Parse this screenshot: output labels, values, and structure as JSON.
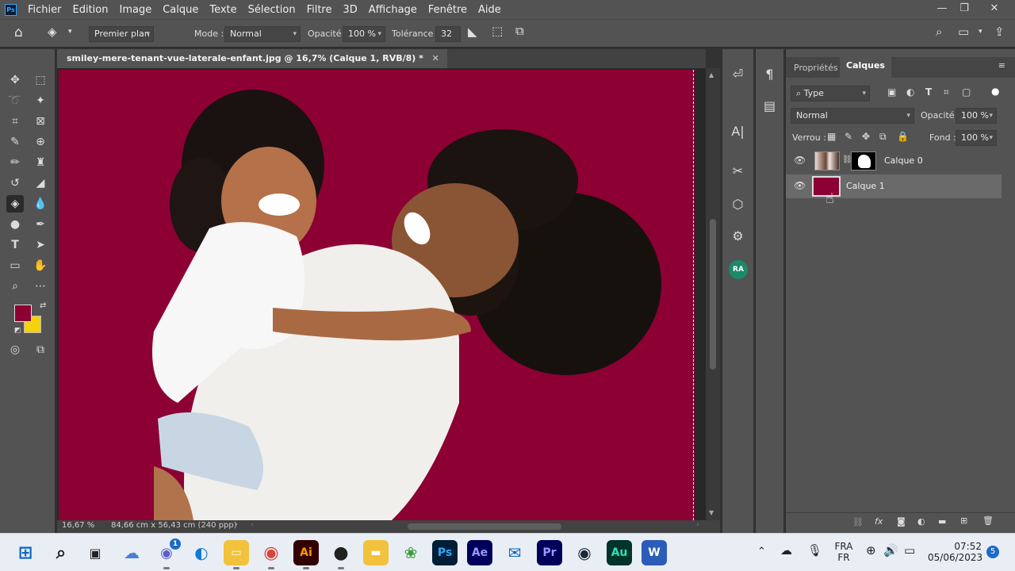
{
  "app": {
    "logo": "Ps"
  },
  "menu": [
    "Fichier",
    "Edition",
    "Image",
    "Calque",
    "Texte",
    "Sélection",
    "Filtre",
    "3D",
    "Affichage",
    "Fenêtre",
    "Aide"
  ],
  "window_controls": {
    "minimize": "—",
    "restore": "❐",
    "close": "✕"
  },
  "options": {
    "fill_source": "Premier plan",
    "mode_label": "Mode :",
    "mode_value": "Normal",
    "opacity_label": "Opacité :",
    "opacity_value": "100 %",
    "tolerance_label": "Tolérance :",
    "tolerance_value": "32"
  },
  "document": {
    "tab_title": "smiley-mere-tenant-vue-laterale-enfant.jpg @ 16,7% (Calque 1, RVB/8) *",
    "tab_close": "✕",
    "zoom": "16,67 %",
    "doc_size": "84,66 cm x 56,43 cm (240 ppp)",
    "canvas_color": "#8c0034"
  },
  "colors": {
    "foreground": "#8c0034",
    "background": "#f5d20a"
  },
  "panel": {
    "tab_properties": "Propriétés",
    "tab_layers": "Calques",
    "filter_type": "Type",
    "blend_mode": "Normal",
    "opacity_label": "Opacité :",
    "opacity_value": "100 %",
    "lock_label": "Verrou :",
    "fill_label": "Fond :",
    "fill_value": "100 %",
    "layers": [
      {
        "name": "Calque 0",
        "selected": false
      },
      {
        "name": "Calque 1",
        "selected": true
      }
    ]
  },
  "taskbar": {
    "apps": [
      "windows-start",
      "search",
      "task-view",
      "widgets",
      "teams",
      "edge",
      "file-explorer",
      "chrome",
      "illustrator",
      "media-player",
      "folder",
      "green-app",
      "photoshop",
      "after-effects",
      "mail",
      "premiere-pro",
      "steam",
      "audition",
      "word"
    ],
    "teams_badge": "1",
    "ai_label": "Ai",
    "ps_label": "Ps",
    "ae_label": "Ae",
    "pr_label": "Pr",
    "au_label": "Au",
    "w_label": "W",
    "lang_top": "FRA",
    "lang_bottom": "FR",
    "time": "07:52",
    "date": "05/06/2023",
    "notif_count": "5"
  }
}
